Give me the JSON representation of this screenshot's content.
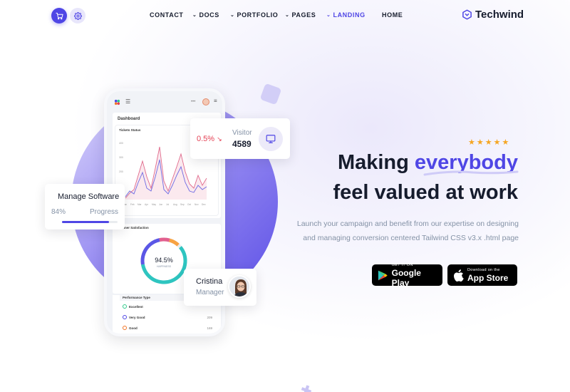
{
  "nav": {
    "items": [
      {
        "label": "CONTACT",
        "has_chevron": false,
        "active": false
      },
      {
        "label": "DOCS",
        "has_chevron": true,
        "active": false
      },
      {
        "label": "PORTFOLIO",
        "has_chevron": true,
        "active": false
      },
      {
        "label": "PAGES",
        "has_chevron": true,
        "active": false
      },
      {
        "label": "LANDING",
        "has_chevron": true,
        "active": true
      },
      {
        "label": "HOME",
        "has_chevron": false,
        "active": false
      }
    ],
    "cart_icon": "cart-icon",
    "settings_icon": "gear-icon",
    "brand_name": "Techwind"
  },
  "phone": {
    "dashboard_title": "Dashboard",
    "tickets_title": "Tickets Status",
    "chart_months": [
      "Jan",
      "Feb",
      "Mar",
      "Apr",
      "May",
      "Jun",
      "Jul",
      "Aug",
      "Sep",
      "Oct",
      "Nov",
      "Dec"
    ],
    "chart_yticks": [
      "400",
      "300",
      "200"
    ],
    "satisfaction_title": "Customer Satisfaction",
    "satisfaction_value": "94.5%",
    "satisfaction_label": "HAPPINESS",
    "performance_title": "Performance Type",
    "performance_rows": [
      {
        "label": "Excellent",
        "value": "",
        "color": "#2eca8b"
      },
      {
        "label": "Very Good",
        "value": "209",
        "color": "#4f46e5"
      },
      {
        "label": "Good",
        "value": "169",
        "color": "#f17425"
      }
    ]
  },
  "visitor": {
    "change": "0.5%",
    "label": "Visitor",
    "value": "4589",
    "icon": "monitor-icon"
  },
  "manage": {
    "title": "Manage Software",
    "percent_text": "84%",
    "progress_label": "Progress",
    "percent": 84
  },
  "person": {
    "name": "Cristina",
    "role": "Manager"
  },
  "hero": {
    "stars": 5,
    "line1_prefix": "Making ",
    "line1_accent": "everybody",
    "line2": "feel valued at work",
    "description": "Launch your campaign and benefit from our expertise on designing and managing conversion centered Tailwind CSS v3.x .html page"
  },
  "stores": {
    "google_small": "GET IT ON",
    "google_big": "Google Play",
    "apple_small": "Download on the",
    "apple_big": "App Store"
  },
  "colors": {
    "accent": "#4f46e5",
    "text": "#161c2d",
    "muted": "#8492a6",
    "danger": "#e43f52",
    "star": "#f5a623"
  }
}
